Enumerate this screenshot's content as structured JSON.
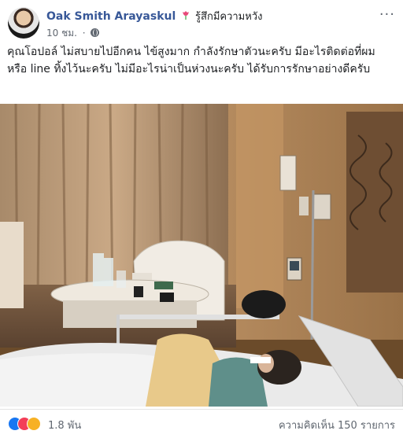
{
  "post": {
    "author": "Oak Smith Arayaskul",
    "feeling": "รู้สึกมีความหวัง",
    "timestamp": "10 ชม.",
    "privacy_icon": "globe-icon",
    "more_label": "···",
    "text": "คุณโอปอล์ ไม่สบายไปอีกคน ไข้สูงมาก กำลังรักษาตัวนะครับ มีอะไรติดต่อที่ผม หรือ line ทิ้งไว้นะครับ ไม่มีอะไรน่าเป็นห่วงนะครับ ได้รับการรักษาอย่างดีครับ"
  },
  "reactions": {
    "icons": [
      "like-icon",
      "love-icon",
      "sad-icon"
    ],
    "count": "1.8 พัน",
    "comments": "ความคิดเห็น 150 รายการ"
  },
  "colors": {
    "name_blue": "#385898",
    "meta_gray": "#606770",
    "like": "#1877f2",
    "love": "#f33e58",
    "sad": "#f7b125"
  }
}
